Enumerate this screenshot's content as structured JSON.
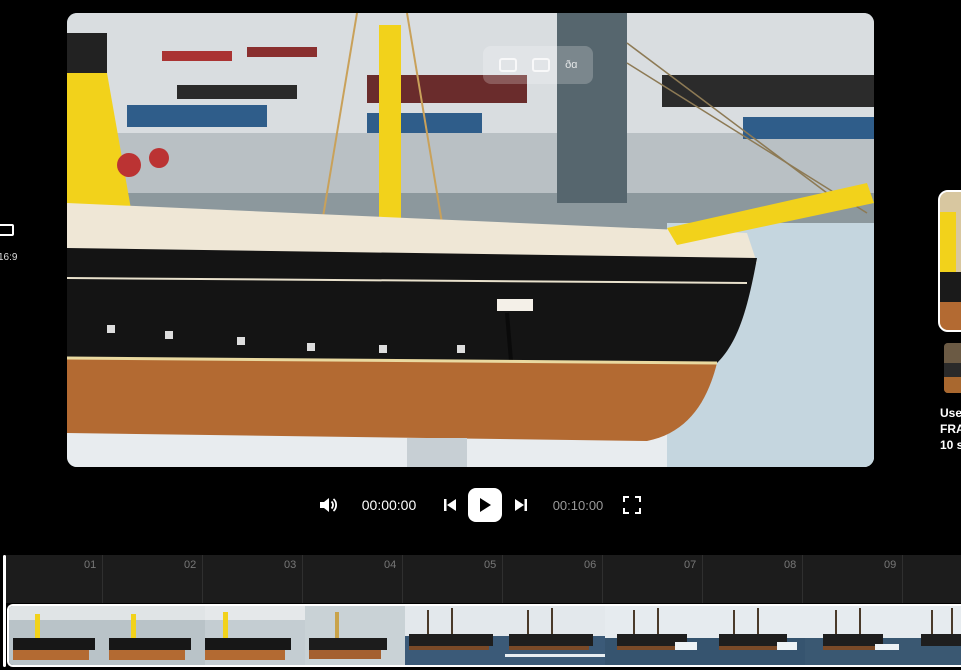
{
  "left_panel": {
    "ratio_label": "16:9"
  },
  "preview": {
    "overlay_text": "ðɑ"
  },
  "right_panel": {
    "text_lines": [
      "Use",
      "FRA",
      "10 s"
    ]
  },
  "controls": {
    "current_time": "00:00:00",
    "total_time": "00:10:00"
  },
  "timeline": {
    "ticks": [
      "01",
      "02",
      "03",
      "04",
      "05",
      "06",
      "07",
      "08",
      "09"
    ]
  },
  "colors": {
    "accent": "#ffffff",
    "ship_yellow": "#f2d21b",
    "hull_black": "#141414",
    "hull_wood": "#b36a32",
    "sea": "#3b5a78"
  }
}
